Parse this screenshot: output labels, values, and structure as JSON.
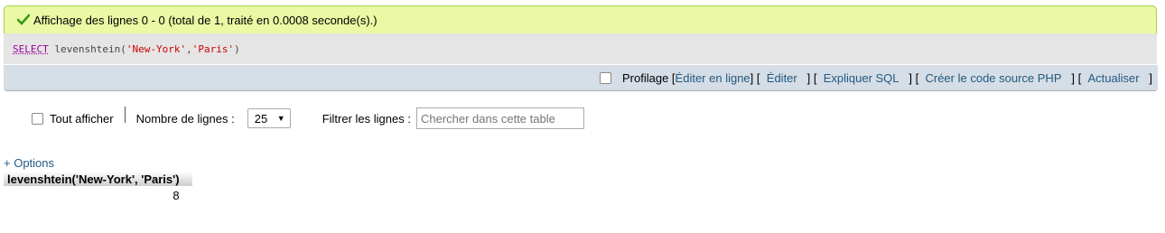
{
  "message": {
    "text": "Affichage des lignes 0 - 0 (total de 1, traité en 0.0008 seconde(s).)"
  },
  "sql": {
    "keyword": "SELECT",
    "func": "levenshtein(",
    "arg1": "'New-York'",
    "comma": ", ",
    "arg2": "'Paris'",
    "close": ")"
  },
  "toolbar": {
    "profiling_label": "Profilage",
    "bracket_open": "[",
    "bracket_close": "]",
    "edit_inline": "Éditer en ligne",
    "edit": "Éditer",
    "explain": "Expliquer SQL",
    "php_code": "Créer le code source PHP",
    "refresh": "Actualiser"
  },
  "navigation": {
    "show_all_label": "Tout afficher",
    "rows_label": "Nombre de lignes :",
    "rows_value": "25",
    "filter_label": "Filtrer les lignes :",
    "filter_placeholder": "Chercher dans cette table"
  },
  "options_link": "+ Options",
  "results": {
    "columns": [
      "levenshtein('New-York', 'Paris')"
    ],
    "rows": [
      [
        "8"
      ]
    ]
  },
  "colors": {
    "success_bg": "#ebf8a4",
    "success_border": "#a2d246",
    "link": "#235a81",
    "toolbar_bg": "#d5dde6"
  }
}
